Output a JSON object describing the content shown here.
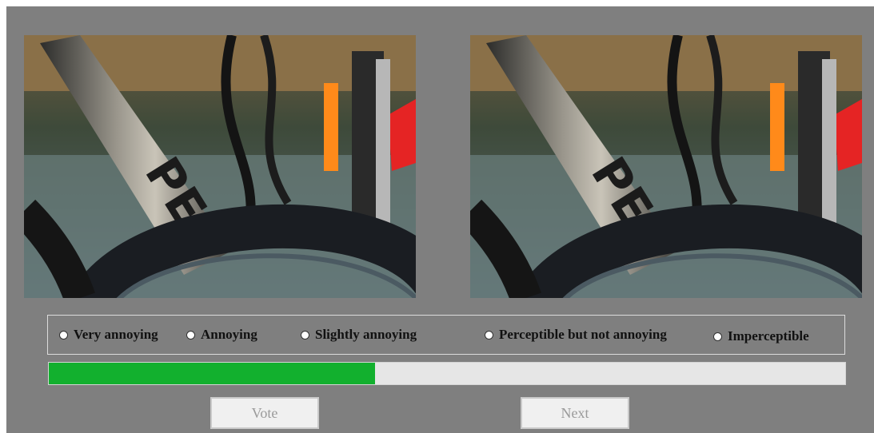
{
  "stimuli": {
    "left_image": {
      "description_icon": "bicycle-photo"
    },
    "right_image": {
      "description_icon": "bicycle-photo"
    }
  },
  "rating": {
    "options": [
      {
        "label": "Very annoying",
        "selected": false
      },
      {
        "label": "Annoying",
        "selected": false
      },
      {
        "label": "Slightly annoying",
        "selected": false
      },
      {
        "label": "Perceptible but not annoying",
        "selected": false
      },
      {
        "label": "Imperceptible",
        "selected": false
      }
    ]
  },
  "progress": {
    "value": 0.41,
    "color": "#12b02e"
  },
  "buttons": {
    "vote_label": "Vote",
    "next_label": "Next"
  },
  "colors": {
    "background": "#7f7f7f",
    "track": "#e6e6e6"
  }
}
